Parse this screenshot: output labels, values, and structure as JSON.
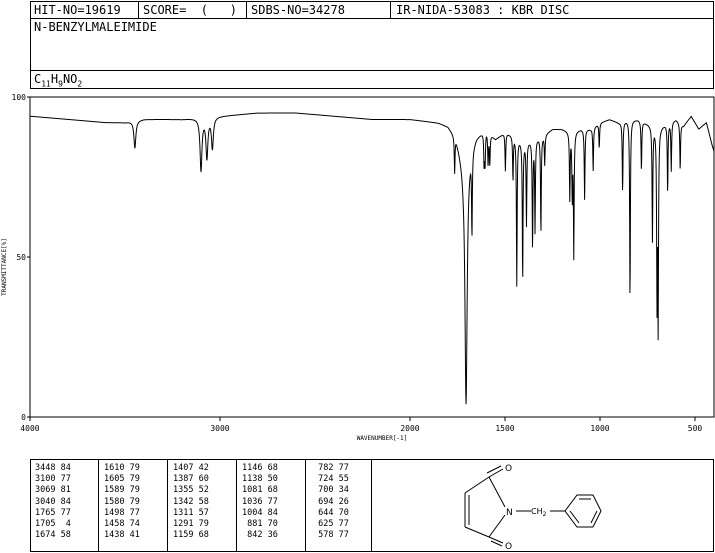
{
  "header": {
    "hit_no": "HIT-NO=19619",
    "score": "SCORE=  (   )",
    "sdbs_no": "SDBS-NO=34278",
    "ir_nida": "IR-NIDA-53083 : KBR DISC",
    "compound_name": "N-BENZYLMALEIMIDE",
    "formula_parts": [
      "C",
      "11",
      "H",
      "9",
      "NO",
      "2"
    ]
  },
  "chart_data": {
    "type": "line",
    "title": "",
    "xlabel": "WAVENUMBER[-1]",
    "ylabel": "TRANSMITTANCE[%]",
    "xlim": [
      4000,
      400
    ],
    "ylim": [
      0,
      100
    ],
    "x_ticks": [
      4000,
      3000,
      2000,
      1500,
      1000,
      500
    ],
    "y_ticks": [
      0,
      50,
      100
    ],
    "x_tick_labels": [
      "4000",
      "3000",
      "2000",
      "1500",
      "1000",
      "500"
    ],
    "y_tick_labels": [
      "0",
      "50",
      "100"
    ],
    "baseline": [
      [
        4000,
        94
      ],
      [
        3800,
        93
      ],
      [
        3600,
        92
      ],
      [
        3500,
        92
      ],
      [
        3400,
        93
      ],
      [
        3200,
        93
      ],
      [
        3000,
        94
      ],
      [
        2800,
        95
      ],
      [
        2600,
        95
      ],
      [
        2400,
        94
      ],
      [
        2200,
        93
      ],
      [
        2000,
        93
      ],
      [
        1850,
        92
      ],
      [
        1800,
        91
      ],
      [
        1760,
        88
      ],
      [
        1720,
        80
      ],
      [
        1650,
        88
      ],
      [
        1600,
        90
      ],
      [
        1550,
        87
      ],
      [
        1500,
        89
      ],
      [
        1450,
        88
      ],
      [
        1400,
        86
      ],
      [
        1350,
        87
      ],
      [
        1300,
        88
      ],
      [
        1250,
        90
      ],
      [
        1200,
        90
      ],
      [
        1150,
        89
      ],
      [
        1100,
        90
      ],
      [
        1050,
        90
      ],
      [
        1000,
        92
      ],
      [
        950,
        93
      ],
      [
        900,
        92
      ],
      [
        850,
        93
      ],
      [
        800,
        93
      ],
      [
        760,
        92
      ],
      [
        720,
        91
      ],
      [
        680,
        91
      ],
      [
        640,
        92
      ],
      [
        600,
        93
      ],
      [
        560,
        91
      ],
      [
        520,
        94
      ],
      [
        480,
        90
      ],
      [
        440,
        92
      ],
      [
        410,
        85
      ],
      [
        400,
        83
      ]
    ],
    "peaks": [
      {
        "wavenumber": 3448,
        "transmittance": 84
      },
      {
        "wavenumber": 3100,
        "transmittance": 77
      },
      {
        "wavenumber": 3069,
        "transmittance": 81
      },
      {
        "wavenumber": 3040,
        "transmittance": 84
      },
      {
        "wavenumber": 1765,
        "transmittance": 77
      },
      {
        "wavenumber": 1705,
        "transmittance": 4
      },
      {
        "wavenumber": 1674,
        "transmittance": 58
      },
      {
        "wavenumber": 1610,
        "transmittance": 79
      },
      {
        "wavenumber": 1605,
        "transmittance": 79
      },
      {
        "wavenumber": 1589,
        "transmittance": 79
      },
      {
        "wavenumber": 1580,
        "transmittance": 79
      },
      {
        "wavenumber": 1498,
        "transmittance": 77
      },
      {
        "wavenumber": 1458,
        "transmittance": 74
      },
      {
        "wavenumber": 1438,
        "transmittance": 41
      },
      {
        "wavenumber": 1407,
        "transmittance": 42
      },
      {
        "wavenumber": 1387,
        "transmittance": 60
      },
      {
        "wavenumber": 1355,
        "transmittance": 52
      },
      {
        "wavenumber": 1342,
        "transmittance": 58
      },
      {
        "wavenumber": 1311,
        "transmittance": 57
      },
      {
        "wavenumber": 1291,
        "transmittance": 79
      },
      {
        "wavenumber": 1159,
        "transmittance": 68
      },
      {
        "wavenumber": 1146,
        "transmittance": 68
      },
      {
        "wavenumber": 1138,
        "transmittance": 50
      },
      {
        "wavenumber": 1081,
        "transmittance": 68
      },
      {
        "wavenumber": 1036,
        "transmittance": 77
      },
      {
        "wavenumber": 1004,
        "transmittance": 84
      },
      {
        "wavenumber": 881,
        "transmittance": 70
      },
      {
        "wavenumber": 842,
        "transmittance": 36
      },
      {
        "wavenumber": 782,
        "transmittance": 77
      },
      {
        "wavenumber": 724,
        "transmittance": 55
      },
      {
        "wavenumber": 700,
        "transmittance": 34
      },
      {
        "wavenumber": 694,
        "transmittance": 26
      },
      {
        "wavenumber": 644,
        "transmittance": 70
      },
      {
        "wavenumber": 625,
        "transmittance": 77
      },
      {
        "wavenumber": 578,
        "transmittance": 77
      }
    ]
  },
  "peak_table": {
    "columns": [
      [
        "3448 84",
        "3100 77",
        "3069 81",
        "3040 84",
        "1765 77",
        "1705  4",
        "1674 58"
      ],
      [
        "1610 79",
        "1605 79",
        "1589 79",
        "1580 79",
        "1498 77",
        "1458 74",
        "1438 41"
      ],
      [
        "1407 42",
        "1387 60",
        "1355 52",
        "1342 58",
        "1311 57",
        "1291 79",
        "1159 68"
      ],
      [
        "1146 68",
        "1138 50",
        "1081 68",
        "1036 77",
        "1004 84",
        " 881 70",
        " 842 36"
      ],
      [
        " 782 77",
        " 724 55",
        " 700 34",
        " 694 26",
        " 644 70",
        " 625 77",
        " 578 77"
      ]
    ]
  },
  "structure": {
    "atom_labels": {
      "o_top": "O",
      "n": "N",
      "o_bottom": "O",
      "ch2": "CH",
      "ch2_sub": "2"
    }
  }
}
